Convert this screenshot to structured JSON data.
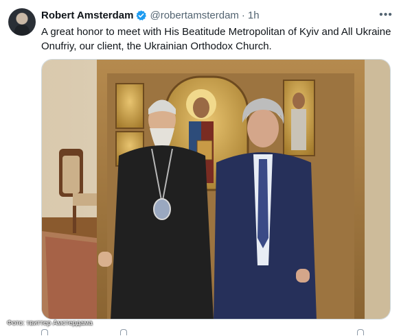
{
  "tweet": {
    "author_name": "Robert Amsterdam",
    "handle": "@robertamsterdam",
    "separator": "·",
    "time": "1h",
    "text": "A great honor to meet with His Beatitude Metropolitan of Kyiv and All Ukraine Onufriy, our client, the Ukrainian Orthodox Church.",
    "more_icon": "more-horizontal-icon",
    "verified_icon": "verified-badge-icon"
  },
  "photo_credit": "Фото: твиттер Амстердама",
  "colors": {
    "verified_blue": "#1d9bf0",
    "text_primary": "#0f1419",
    "text_secondary": "#536471"
  }
}
